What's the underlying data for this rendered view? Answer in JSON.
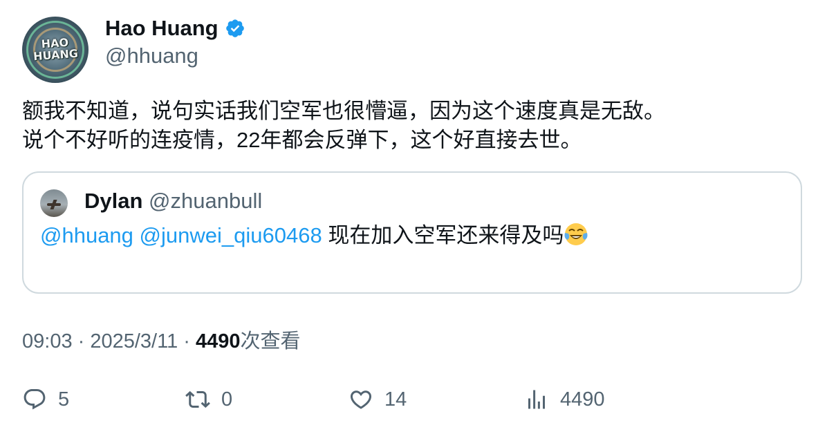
{
  "author": {
    "name": "Hao Huang",
    "handle": "@hhuang",
    "avatar_text": "HAO HUANG",
    "verified_color": "#1d9bf0"
  },
  "tweet": {
    "lines": [
      "额我不知道，说句实话我们空军也很懵逼，因为这个速度真是无敌。",
      "说个不好听的连疫情，22年都会反弹下，这个好直接去世。"
    ]
  },
  "quote": {
    "name": "Dylan",
    "handle": "@zhuanbull",
    "mention1": "@hhuang",
    "mention2": "@junwei_qiu60468",
    "text": " 现在加入空军还来得及吗",
    "emoji": "face-with-tears-of-joy"
  },
  "meta": {
    "time": "09:03",
    "sep1": " · ",
    "date": "2025/3/11",
    "sep2": " · ",
    "views": "4490",
    "views_label": "次查看"
  },
  "actions": {
    "replies": "5",
    "retweets": "0",
    "likes": "14",
    "views": "4490"
  },
  "colors": {
    "text": "#0f1419",
    "secondary": "#536471",
    "link": "#1d9bf0",
    "border": "#cfd9de"
  }
}
